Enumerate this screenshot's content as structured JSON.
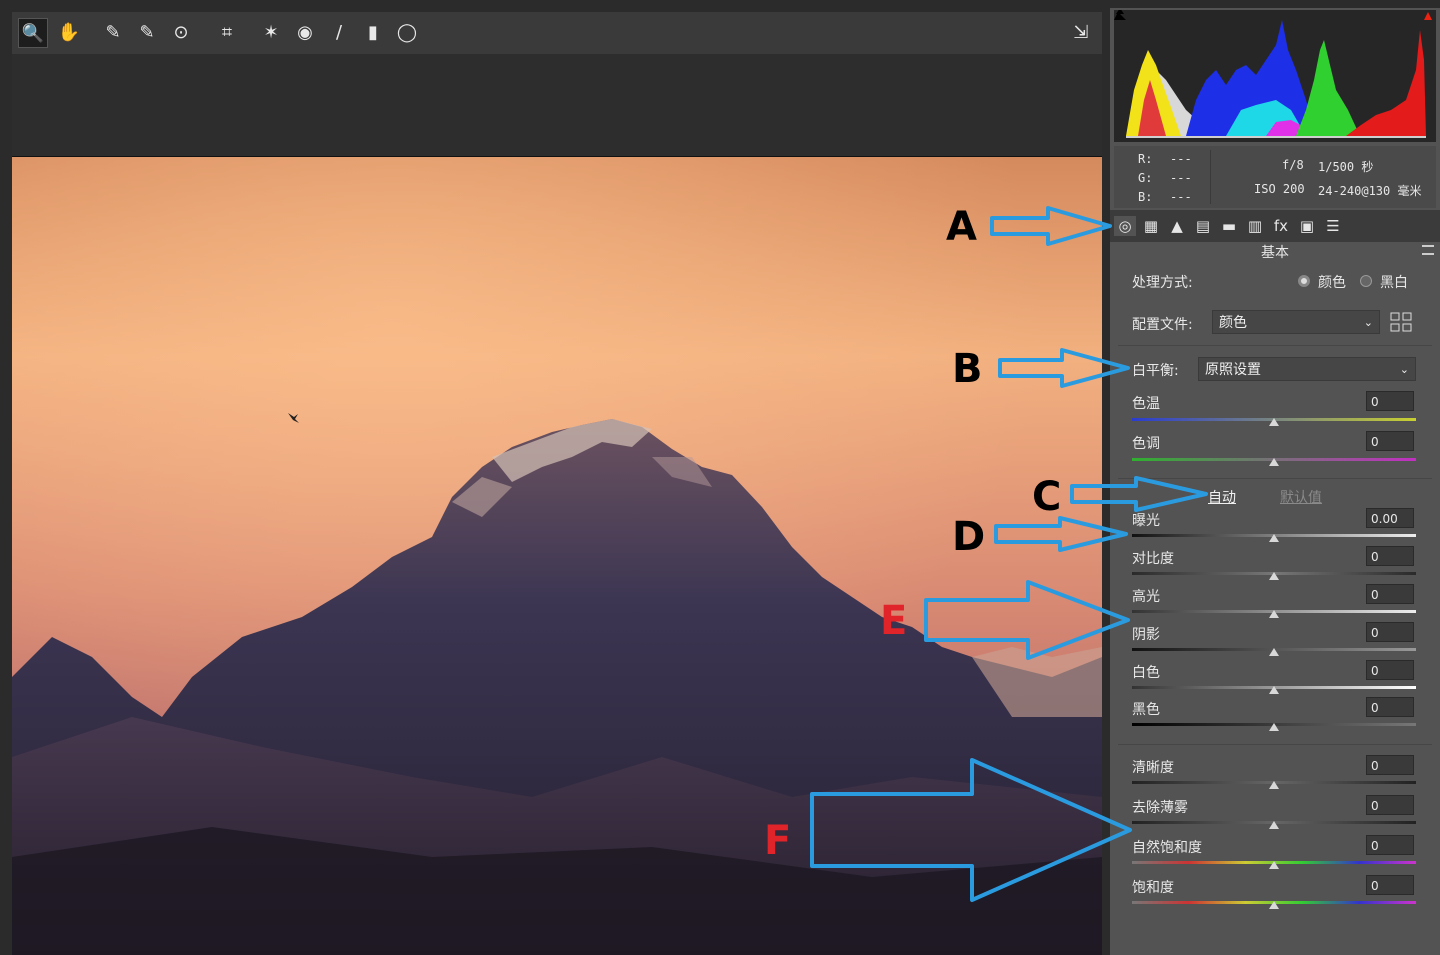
{
  "toolbar": {
    "tools": [
      {
        "name": "zoom-tool-icon",
        "glyph": "🔍"
      },
      {
        "name": "hand-tool-icon",
        "glyph": "✋"
      },
      {
        "name": "white-balance-tool-icon",
        "glyph": "✎"
      },
      {
        "name": "color-sampler-tool-icon",
        "glyph": "✎"
      },
      {
        "name": "targeted-adjustment-tool-icon",
        "glyph": "⊙"
      },
      {
        "name": "crop-tool-icon",
        "glyph": "⌗"
      },
      {
        "name": "spot-removal-tool-icon",
        "glyph": "✶"
      },
      {
        "name": "red-eye-tool-icon",
        "glyph": "◉"
      },
      {
        "name": "adjustment-brush-icon",
        "glyph": "/"
      },
      {
        "name": "graduated-filter-icon",
        "glyph": "▮"
      },
      {
        "name": "radial-filter-icon",
        "glyph": "◯"
      }
    ],
    "export_icon": "⇲"
  },
  "callouts": {
    "A": "A",
    "B": "B",
    "C": "C",
    "D": "D",
    "E": "E",
    "F": "F"
  },
  "info": {
    "r_label": "R:",
    "g_label": "G:",
    "b_label": "B:",
    "r_value": "---",
    "g_value": "---",
    "b_value": "---",
    "aperture": "f/8",
    "shutter": "1/500 秒",
    "iso": "ISO 200",
    "lens": "24-240@130 毫米"
  },
  "tabs": [
    "◎",
    "▦",
    "▲",
    "▤",
    "▬",
    "▥",
    "fx",
    "▣",
    "☰"
  ],
  "panel": {
    "title": "基本",
    "treatment_label": "处理方式:",
    "treatment_color": "颜色",
    "treatment_bw": "黑白",
    "profile_label": "配置文件:",
    "profile_value": "颜色",
    "wb_label": "白平衡:",
    "wb_value": "原照设置",
    "temp_label": "色温",
    "temp_value": "0",
    "tint_label": "色调",
    "tint_value": "0",
    "auto_label": "自动",
    "default_label": "默认值",
    "exposure_label": "曝光",
    "exposure_value": "0.00",
    "contrast_label": "对比度",
    "contrast_value": "0",
    "highlights_label": "高光",
    "highlights_value": "0",
    "shadows_label": "阴影",
    "shadows_value": "0",
    "whites_label": "白色",
    "whites_value": "0",
    "blacks_label": "黑色",
    "blacks_value": "0",
    "clarity_label": "清晰度",
    "clarity_value": "0",
    "dehaze_label": "去除薄雾",
    "dehaze_value": "0",
    "vibrance_label": "自然饱和度",
    "vibrance_value": "0",
    "saturation_label": "饱和度",
    "saturation_value": "0"
  },
  "colors": {
    "arrow": "#2b9be0",
    "callout_red": "#e0242a"
  }
}
